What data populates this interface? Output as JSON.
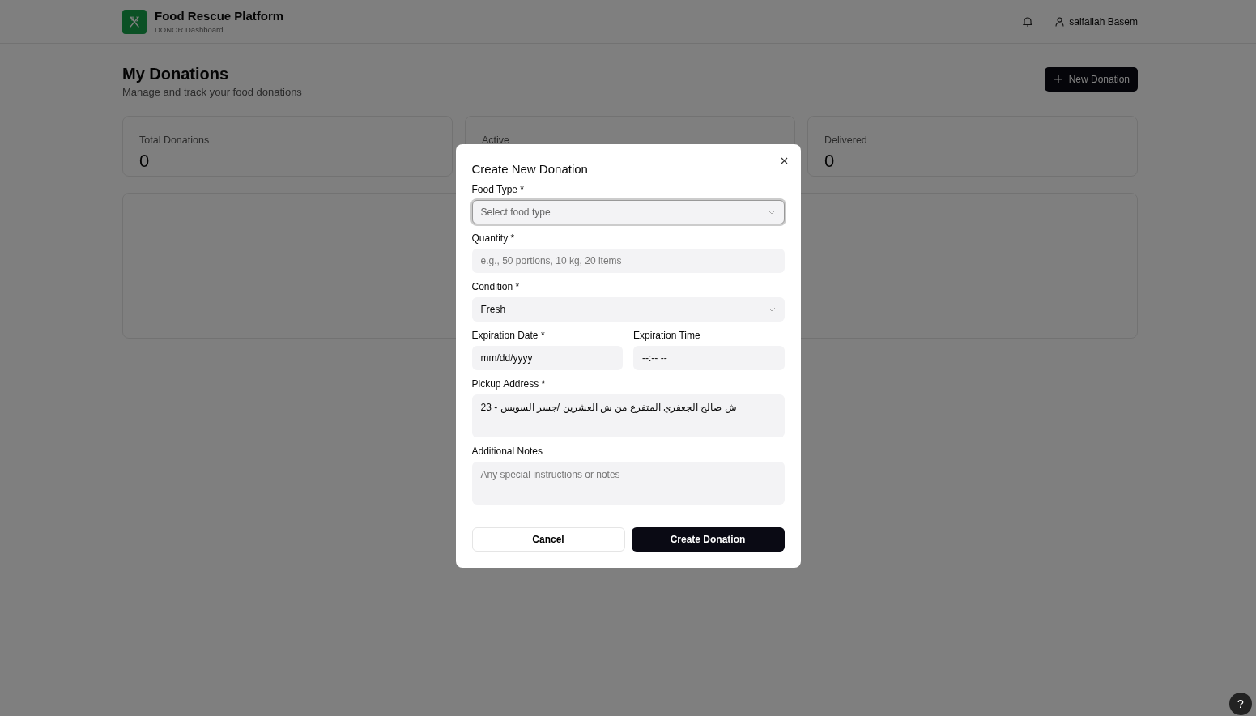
{
  "header": {
    "brand": "Food Rescue Platform",
    "subtitle": "DONOR Dashboard",
    "user": "saifallah Basem"
  },
  "page": {
    "title": "My Donations",
    "subtitle": "Manage and track your food donations",
    "new_button": "New Donation"
  },
  "stats": [
    {
      "label": "Total Donations",
      "value": "0"
    },
    {
      "label": "Active"
    },
    {
      "label": "Delivered",
      "value": "0"
    }
  ],
  "dialog": {
    "title": "Create New Donation",
    "rows": [
      [
        {
          "kind": "select",
          "label": "Food Type *",
          "placeholder": "Select food type",
          "focused": true
        }
      ],
      [
        {
          "kind": "input",
          "label": "Quantity *",
          "placeholder": "e.g., 50 portions, 10 kg, 20 items",
          "focused": false
        }
      ],
      [
        {
          "kind": "select",
          "label": "Condition *",
          "value": "Fresh",
          "focused": false
        }
      ],
      [
        {
          "kind": "input",
          "label": "Expiration Date *",
          "value": "mm/dd/yyyy",
          "focused": false
        },
        {
          "kind": "input",
          "label": "Expiration Time",
          "value": "--:-- --",
          "focused": false
        }
      ],
      [
        {
          "kind": "textarea",
          "label": "Pickup Address *",
          "value": "ش صالح الجعفري المتفرع من ش العشرين /جسر السويس - 23",
          "focused": false
        }
      ],
      [
        {
          "kind": "textarea",
          "label": "Additional Notes",
          "placeholder": "Any special instructions or notes",
          "focused": false
        }
      ]
    ],
    "cancel": "Cancel",
    "submit": "Create Donation"
  },
  "help_button": "?"
}
